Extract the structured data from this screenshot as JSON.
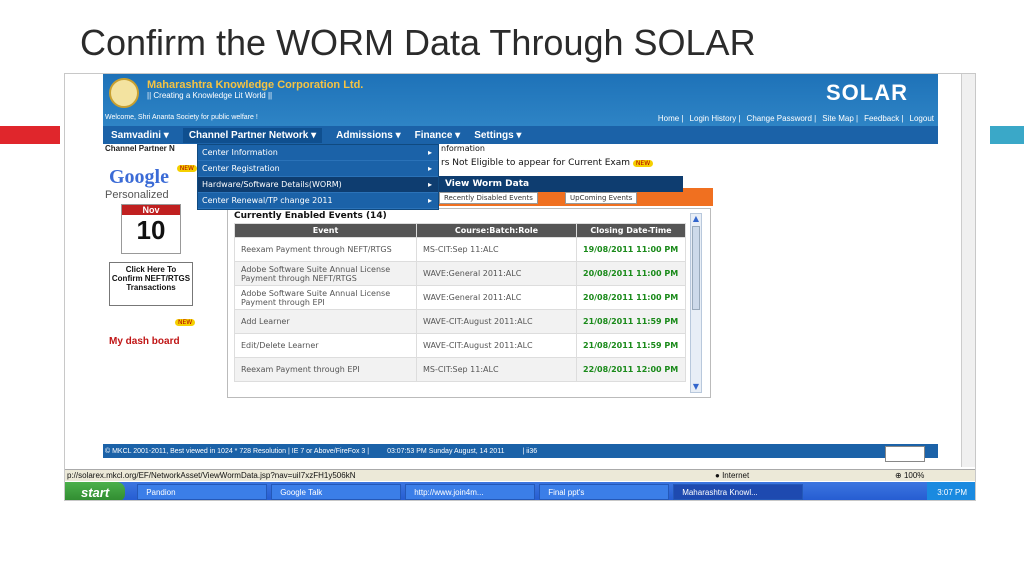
{
  "slide": {
    "title": "Confirm the WORM Data Through SOLAR"
  },
  "header": {
    "org_name": "Maharashtra Knowledge Corporation Ltd.",
    "org_tagline": "|| Creating a Knowledge Lit World ||",
    "product_logo": "SOLAR",
    "welcome": "Welcome, Shri Ananta Society for public welfare !",
    "links": [
      "Home |",
      "Login History |",
      "Change Password |",
      "Site Map |",
      "Feedback |",
      "Logout"
    ]
  },
  "nav": {
    "items": [
      "Samvadini ▾",
      "Channel Partner Network ▾",
      "Admissions ▾",
      "Finance ▾",
      "Settings ▾"
    ]
  },
  "left": {
    "cpn_label": "Channel Partner N",
    "new_badge": "NEW",
    "google": "Google",
    "personalized": "Personalized",
    "calendar_month": "Nov",
    "calendar_day": "10",
    "confirm_box": "Click Here To Confirm NEFT/RTGS Transactions",
    "dashboard": "My dash board"
  },
  "dropdown": {
    "items": [
      "Center Information",
      "Center Registration",
      "Hardware/Software Details(WORM)",
      "Center Renewal/TP change 2011"
    ],
    "submenu": "View Worm Data"
  },
  "info": {
    "line1": "nformation",
    "line2": "rs Not Eligible to appear for Current Exam"
  },
  "tabs": {
    "recent": "Recently Disabled Events",
    "upcoming": "UpComing Events"
  },
  "events": {
    "title": "Currently Enabled Events (14)",
    "columns": [
      "Event",
      "Course:Batch:Role",
      "Closing Date-Time"
    ],
    "rows": [
      [
        "Reexam Payment through NEFT/RTGS",
        "MS-CIT:Sep 11:ALC",
        "19/08/2011 11:00 PM"
      ],
      [
        "Adobe Software Suite Annual License Payment through NEFT/RTGS",
        "WAVE:General 2011:ALC",
        "20/08/2011 11:00 PM"
      ],
      [
        "Adobe Software Suite Annual License Payment through EPI",
        "WAVE:General 2011:ALC",
        "20/08/2011 11:00 PM"
      ],
      [
        "Add Learner",
        "WAVE-CIT:August 2011:ALC",
        "21/08/2011 11:59 PM"
      ],
      [
        "Edit/Delete Learner",
        "WAVE-CIT:August 2011:ALC",
        "21/08/2011 11:59 PM"
      ],
      [
        "Reexam Payment through EPI",
        "MS-CIT:Sep 11:ALC",
        "22/08/2011 12:00 PM"
      ]
    ]
  },
  "footer": {
    "copyright": "© MKCL 2001-2011, Best viewed in 1024 * 728 Resolution | IE 7 or Above/FireFox 3 |",
    "datetime": "03:07:53 PM Sunday August, 14 2011",
    "server": "| ii36"
  },
  "statusbar": {
    "url": "p://solarex.mkcl.org/EF/NetworkAsset/ViewWormData.jsp?nav=uiI7xzFH1y506kN",
    "zone": "Internet",
    "zoom": "100%"
  },
  "taskbar": {
    "start": "start",
    "tasks": [
      "Pandion",
      "Google Talk",
      "http://www.join4m...",
      "Final ppt's",
      "Maharashtra Knowl..."
    ],
    "clock": "3:07 PM"
  }
}
